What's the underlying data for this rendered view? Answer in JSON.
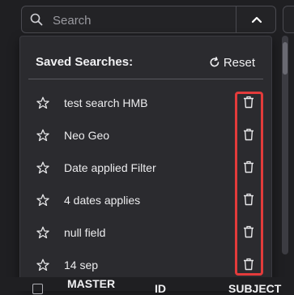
{
  "search": {
    "placeholder": "Search",
    "toggle_icon": "chevron-up-icon"
  },
  "saved_searches": {
    "title": "Saved Searches:",
    "reset_label": "Reset",
    "items": [
      {
        "label": "test search HMB"
      },
      {
        "label": "Neo Geo"
      },
      {
        "label": "Date applied Filter"
      },
      {
        "label": "4 dates applies"
      },
      {
        "label": "null field"
      },
      {
        "label": "14 sep"
      }
    ]
  },
  "table": {
    "columns": [
      "MASTER",
      "ID",
      "SUBJECT"
    ]
  },
  "colors": {
    "background": "#1f1f22",
    "panel": "#2b2b2f",
    "highlight": "#e33b3b"
  }
}
